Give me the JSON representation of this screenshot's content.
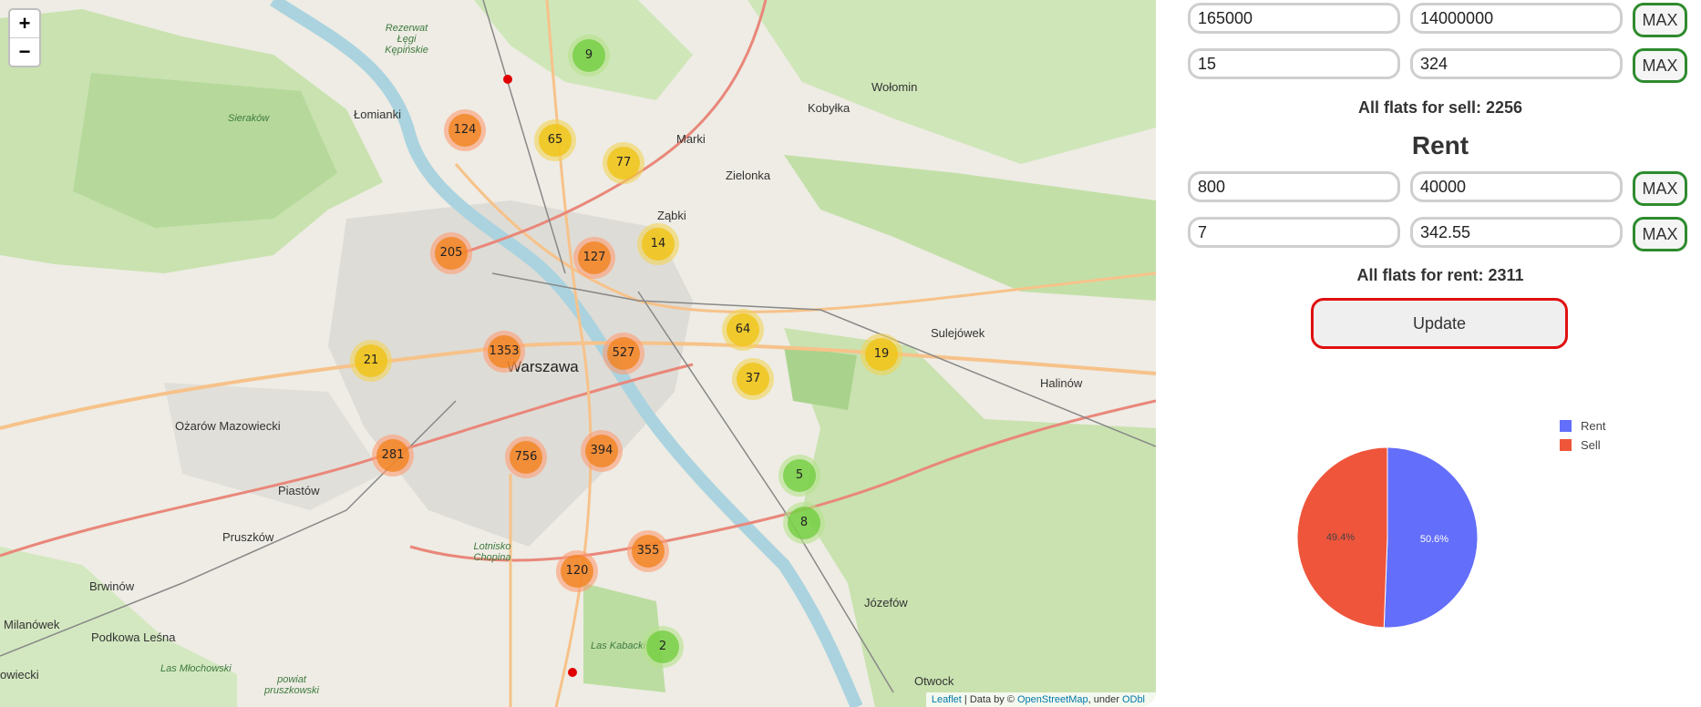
{
  "map": {
    "zoom_in": "+",
    "zoom_out": "−",
    "attribution": {
      "leaflet": "Leaflet",
      "sep": " | Data by © ",
      "osm": "OpenStreetMap",
      "under": ", under ",
      "odbl": "ODbl"
    },
    "clusters": [
      {
        "count": "9",
        "size": "small"
      },
      {
        "count": "124",
        "size": "large"
      },
      {
        "count": "65",
        "size": "medium"
      },
      {
        "count": "77",
        "size": "medium"
      },
      {
        "count": "205",
        "size": "large"
      },
      {
        "count": "127",
        "size": "large"
      },
      {
        "count": "14",
        "size": "medium"
      },
      {
        "count": "64",
        "size": "medium"
      },
      {
        "count": "21",
        "size": "medium"
      },
      {
        "count": "1353",
        "size": "large"
      },
      {
        "count": "527",
        "size": "large"
      },
      {
        "count": "37",
        "size": "medium"
      },
      {
        "count": "19",
        "size": "medium"
      },
      {
        "count": "281",
        "size": "large"
      },
      {
        "count": "756",
        "size": "large"
      },
      {
        "count": "394",
        "size": "large"
      },
      {
        "count": "5",
        "size": "small"
      },
      {
        "count": "8",
        "size": "small"
      },
      {
        "count": "355",
        "size": "large"
      },
      {
        "count": "120",
        "size": "large"
      },
      {
        "count": "2",
        "size": "small"
      }
    ],
    "places": {
      "warszawa": "Warszawa",
      "lomianki": "Łomianki",
      "marki": "Marki",
      "kobylka": "Kobyłka",
      "wolomin": "Wołomin",
      "zielonka": "Zielonka",
      "zabki": "Ząbki",
      "sulejowek": "Sulejówek",
      "halinow": "Halinów",
      "ozarow": "Ożarów Mazowiecki",
      "piastow": "Piastów",
      "pruszkow": "Pruszków",
      "brwinow": "Brwinów",
      "milanowek": "Milanówek",
      "podkowa": "Podkowa Leśna",
      "jozefow": "Józefów",
      "otwock": "Otwock",
      "owiecki": "owiecki",
      "lotnisko": "Lotnisko Chopina",
      "serakow": "Sieraków",
      "kabacki": "Las Kabacki",
      "mlochowski": "Las Młochowski",
      "rezerwat": "Rezerwat Łęgi Kępińskie",
      "powiat": "powiat pruszkowski"
    }
  },
  "sell": {
    "price_min": "165000",
    "price_max": "14000000",
    "area_min": "15",
    "area_max": "324",
    "max_label": "MAX",
    "total_text": "All flats for sell: 2256"
  },
  "rent": {
    "heading": "Rent",
    "price_min": "800",
    "price_max": "40000",
    "area_min": "7",
    "area_max": "342.55",
    "max_label": "MAX",
    "total_text": "All flats for rent: 2311"
  },
  "update_label": "Update",
  "pie": {
    "colors": {
      "rent": "#636efa",
      "sell": "#ef553b"
    },
    "legend": [
      "Rent",
      "Sell"
    ]
  },
  "chart_data": {
    "type": "pie",
    "categories": [
      "Rent",
      "Sell"
    ],
    "values": [
      50.6,
      49.4
    ],
    "labels": [
      "50.6%",
      "49.4%"
    ]
  }
}
